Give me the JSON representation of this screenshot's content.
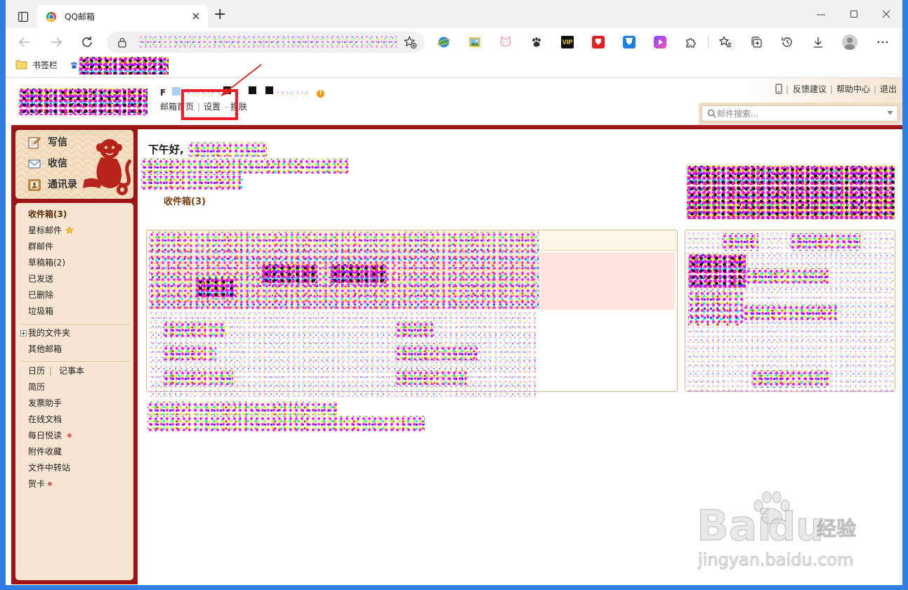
{
  "browser": {
    "tab": {
      "title": "QQ邮箱",
      "favicon": "browser-favicon-icon",
      "close_icon": "close-icon"
    },
    "new_tab": "+",
    "window_controls": [
      "minimize-icon",
      "maximize-icon",
      "close-window-icon"
    ],
    "toolbar_icons": [
      "back-icon",
      "forward-icon",
      "refresh-icon",
      "lock-icon",
      "add-favorite-icon",
      "favorites-icon",
      "collections-icon",
      "history-icon",
      "download-icon",
      "profile-avatar-icon",
      "more-icon"
    ],
    "extensions": {
      "icons": [
        "globe-extension-icon",
        "image-extension-icon",
        "cat-extension-icon",
        "paw-extension-icon",
        "vip-extension-icon",
        "red-extension-icon",
        "blue-extension-icon",
        "video-extension-icon",
        "puzzle-icon"
      ],
      "vip_label": "VIP"
    },
    "bookmarks_bar": {
      "folder": "书签栏"
    }
  },
  "header": {
    "user_initial": "F",
    "nav": {
      "home": "邮箱首页",
      "sep": "|",
      "settings": "设置",
      "dash": "-",
      "skin": "换肤"
    },
    "top_links": {
      "sep": "|",
      "feedback": "反馈建议",
      "help": "帮助中心",
      "logout": "退出"
    },
    "search": {
      "placeholder": "邮件搜索..."
    }
  },
  "sidebar": {
    "actions": [
      {
        "label": "写信",
        "icon": "compose-icon"
      },
      {
        "label": "收信",
        "icon": "receive-mail-icon"
      },
      {
        "label": "通讯录",
        "icon": "contacts-icon"
      }
    ],
    "folders": [
      {
        "label": "收件箱(3)",
        "active": true
      },
      {
        "label": "星标邮件",
        "icon": "star-icon"
      },
      {
        "label": "群邮件"
      },
      {
        "label": "草稿箱(2)"
      },
      {
        "label": "已发送"
      },
      {
        "label": "已删除"
      },
      {
        "label": "垃圾箱"
      }
    ],
    "my_folders": "我的文件夹",
    "other_mailboxes": "其他邮箱",
    "tools": {
      "calendar": "日历",
      "sep": "|",
      "notes": "记事本"
    },
    "apps": [
      {
        "label": "简历"
      },
      {
        "label": "发票助手"
      },
      {
        "label": "在线文档"
      },
      {
        "label": "每日悦读",
        "has_dot": true
      },
      {
        "label": "附件收藏"
      },
      {
        "label": "文件中转站"
      },
      {
        "label": "贺卡",
        "has_dot": true
      }
    ]
  },
  "main": {
    "greeting": "下午好,",
    "inbox_link": "收件箱(3)"
  },
  "watermark": {
    "brand_left": "Bai",
    "brand_right": "du",
    "brand_cn": "经验",
    "url": "jingyan.baidu.com"
  },
  "colors": {
    "frame_red": "#9e1414",
    "highlight_red": "#ee1c25",
    "sidebar_bg": "#f8e6d2",
    "desktop_blue": "#2f7ee0",
    "inbox_brown": "#7a3e14"
  }
}
